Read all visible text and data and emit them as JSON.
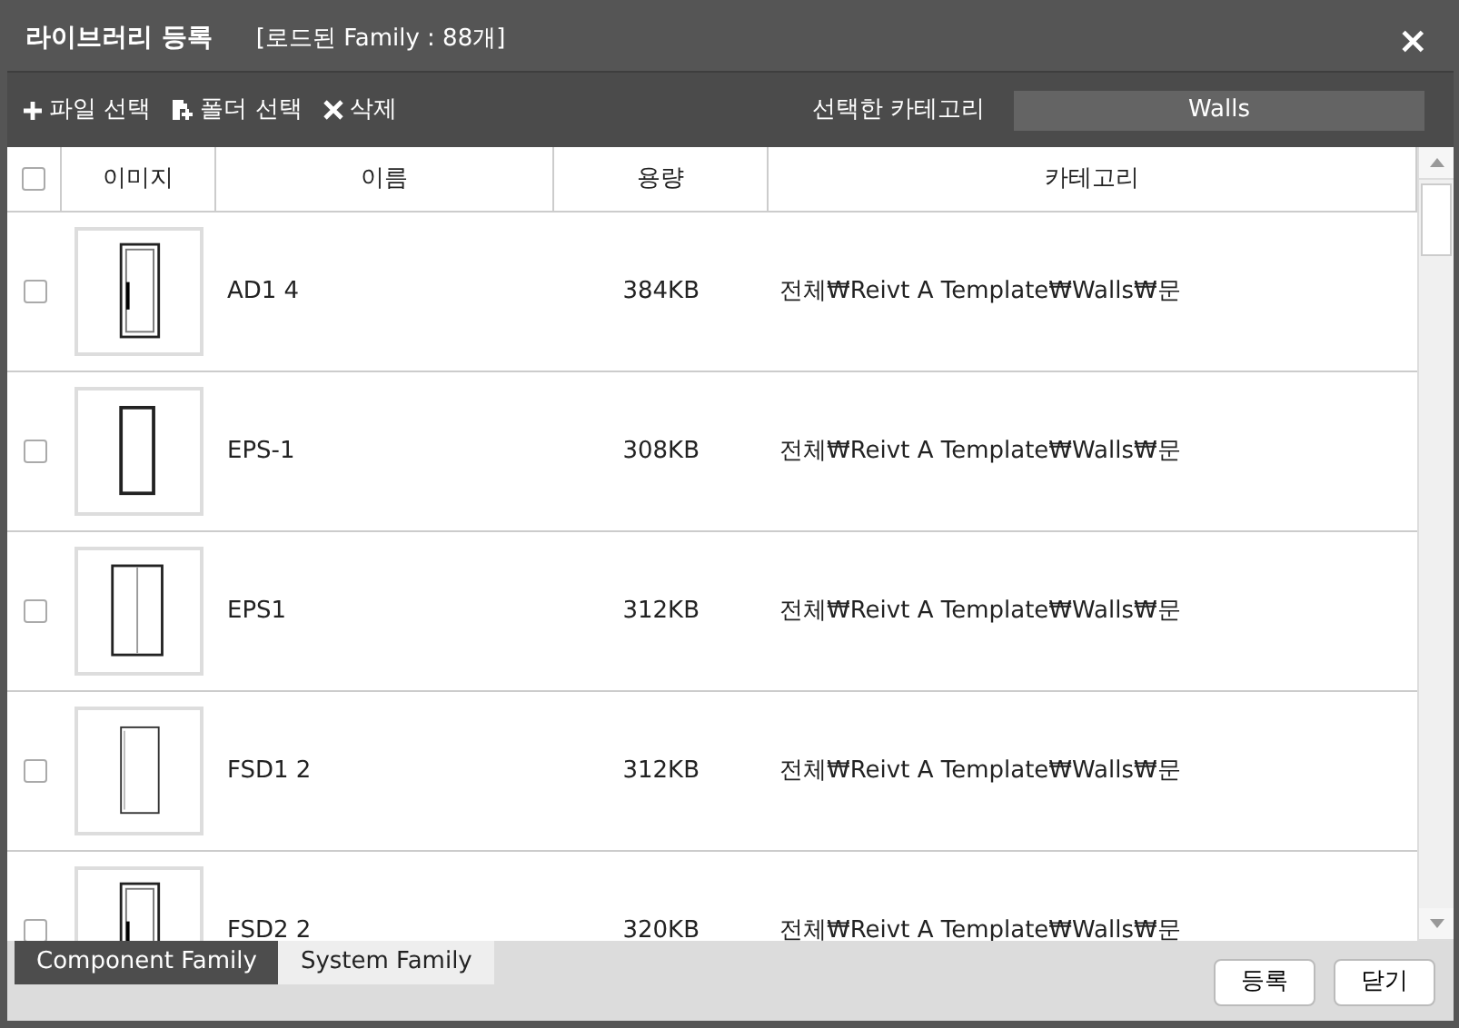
{
  "window": {
    "title": "라이브러리 등록",
    "subtitle": "[로드된 Family : 88개]",
    "close": "×"
  },
  "toolbar": {
    "buttons": [
      {
        "kind": "add",
        "label": "파일 선택"
      },
      {
        "kind": "folder",
        "label": "폴더 선택"
      },
      {
        "kind": "delete",
        "label": "삭제"
      }
    ],
    "category_label": "선택한 카테고리",
    "category_value": "Walls"
  },
  "table": {
    "select_all": {
      "checked": false
    },
    "columns": [
      "이미지",
      "이름",
      "용량",
      "카테고리"
    ],
    "rows": [
      {
        "checked": false,
        "name": "AD1 4",
        "size": "384KB",
        "category": "전체₩Reivt A Template₩Walls₩문"
      },
      {
        "checked": false,
        "name": "EPS-1",
        "size": "308KB",
        "category": "전체₩Reivt A Template₩Walls₩문"
      },
      {
        "checked": false,
        "name": "EPS1",
        "size": "312KB",
        "category": "전체₩Reivt A Template₩Walls₩문"
      },
      {
        "checked": false,
        "name": "FSD1 2",
        "size": "312KB",
        "category": "전체₩Reivt A Template₩Walls₩문"
      },
      {
        "checked": false,
        "name": "FSD2 2",
        "size": "320KB",
        "category": "전체₩Reivt A Template₩Walls₩문"
      }
    ]
  },
  "footer": {
    "tabs": [
      {
        "label": "Component Family",
        "selected": true
      },
      {
        "label": "System Family",
        "selected": false
      }
    ],
    "buttons": [
      "등록",
      "닫기"
    ]
  }
}
